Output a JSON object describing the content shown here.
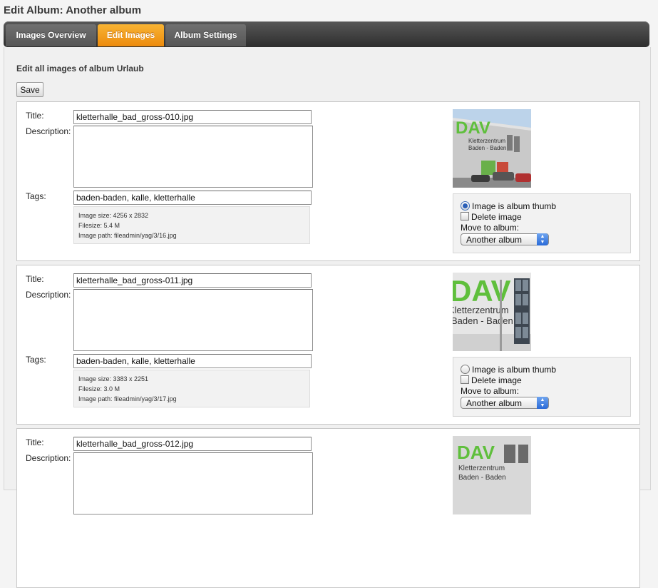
{
  "page_title": "Edit Album: Another album",
  "tabs": [
    {
      "label": "Images Overview",
      "active": false
    },
    {
      "label": "Edit Images",
      "active": true
    },
    {
      "label": "Album Settings",
      "active": false
    }
  ],
  "section_title": "Edit all images of album Urlaub",
  "save_label": "Save",
  "labels": {
    "title": "Title:",
    "description": "Description:",
    "tags": "Tags:",
    "album_thumb": "Image is album thumb",
    "delete": "Delete image",
    "move_to": "Move to album:"
  },
  "images": [
    {
      "title": "kletterhalle_bad_gross-010.jpg",
      "description": "",
      "tags": "baden-baden, kalle, kletterhalle",
      "size": "Image size: 4256 x 2832",
      "filesize": "Filesize: 5.4 M",
      "path": "Image path: fileadmin/yag/3/16.jpg",
      "is_album_thumb": true,
      "delete": false,
      "move_to": "Another album"
    },
    {
      "title": "kletterhalle_bad_gross-011.jpg",
      "description": "",
      "tags": "baden-baden, kalle, kletterhalle",
      "size": "Image size: 3383 x 2251",
      "filesize": "Filesize: 3.0 M",
      "path": "Image path: fileadmin/yag/3/17.jpg",
      "is_album_thumb": false,
      "delete": false,
      "move_to": "Another album"
    },
    {
      "title": "kletterhalle_bad_gross-012.jpg",
      "description": ""
    }
  ],
  "thumb_texts": {
    "logo": "DAV",
    "line1": "Kletterzentrum",
    "line2": "Baden - Baden"
  },
  "colors": {
    "active_tab": "#f39a1c",
    "logo_green": "#5fbf3c",
    "select_arrow": "#2a6ad8"
  }
}
